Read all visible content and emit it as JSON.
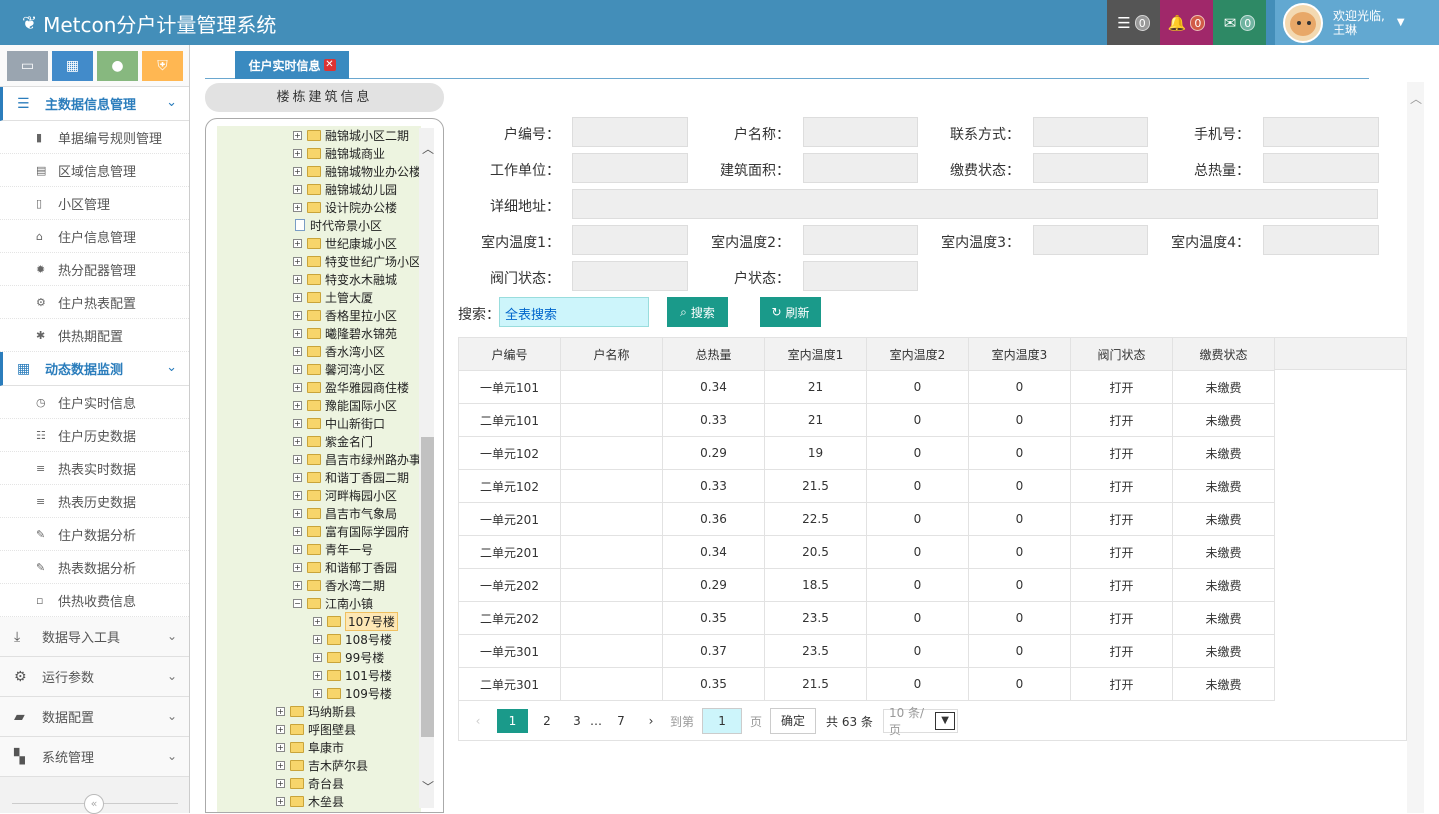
{
  "app": {
    "title": "Metcon分户计量管理系统"
  },
  "header": {
    "badges": [
      {
        "icon": "tasks-icon",
        "count": "0"
      },
      {
        "icon": "bell-icon",
        "count": "0"
      },
      {
        "icon": "envelope-icon",
        "count": "0"
      }
    ],
    "user": {
      "welcome": "欢迎光临,",
      "name": "王琳"
    }
  },
  "sidebar": {
    "groups": [
      {
        "label": "主数据信息管理",
        "items": [
          "单据编号规则管理",
          "区域信息管理",
          "小区管理",
          "住户信息管理",
          "热分配器管理",
          "住户热表配置",
          "供热期配置"
        ]
      },
      {
        "label": "动态数据监测",
        "items": [
          "住户实时信息",
          "住户历史数据",
          "热表实时数据",
          "热表历史数据",
          "住户数据分析",
          "热表数据分析",
          "供热收费信息"
        ]
      }
    ],
    "collapsed": [
      "数据导入工具",
      "运行参数",
      "数据配置",
      "系统管理"
    ],
    "collapse_glyph": "«"
  },
  "tabs": [
    {
      "label": "住户实时信息"
    }
  ],
  "tree": {
    "header": "楼栋建筑信息",
    "nodes": [
      "融锦城小区二期",
      "融锦城商业",
      "融锦城物业办公楼",
      "融锦城幼儿园",
      "设计院办公楼",
      "时代帝景小区",
      "世纪康城小区",
      "特变世纪广场小区",
      "特变水木融城",
      "土管大厦",
      "香格里拉小区",
      "曦隆碧水锦苑",
      "香水湾小区",
      "馨河湾小区",
      "盈华雅园商住楼",
      "豫能国际小区",
      "中山新街口",
      "紫金名门",
      "昌吉市绿州路办事",
      "和谐丁香园二期",
      "河畔梅园小区",
      "昌吉市气象局",
      "富有国际学园府",
      "青年一号",
      "和谐郁丁香园",
      "香水湾二期",
      "江南小镇"
    ],
    "children": [
      "107号楼",
      "108号楼",
      "99号楼",
      "101号楼",
      "109号楼"
    ],
    "lower": [
      "玛纳斯县",
      "呼图壁县",
      "阜康市",
      "吉木萨尔县",
      "奇台县",
      "木垒县"
    ]
  },
  "form": {
    "row1": [
      "户编号：",
      "户名称：",
      "联系方式：",
      "手机号："
    ],
    "row2": [
      "工作单位：",
      "建筑面积：",
      "缴费状态：",
      "总热量："
    ],
    "address": "详细地址：",
    "row4": [
      "室内温度1：",
      "室内温度2：",
      "室内温度3：",
      "室内温度4："
    ],
    "row5": [
      "阀门状态：",
      "户状态："
    ]
  },
  "search": {
    "label": "搜索：",
    "scope": "全表搜索",
    "search_btn": "搜索",
    "refresh_btn": "刷新"
  },
  "table": {
    "headers": [
      "户编号",
      "户名称",
      "总热量",
      "室内温度1",
      "室内温度2",
      "室内温度3",
      "阀门状态",
      "缴费状态"
    ],
    "rows": [
      [
        "一单元101",
        "",
        "0.34",
        "21",
        "0",
        "0",
        "打开",
        "未缴费"
      ],
      [
        "二单元101",
        "",
        "0.33",
        "21",
        "0",
        "0",
        "打开",
        "未缴费"
      ],
      [
        "一单元102",
        "",
        "0.29",
        "19",
        "0",
        "0",
        "打开",
        "未缴费"
      ],
      [
        "二单元102",
        "",
        "0.33",
        "21.5",
        "0",
        "0",
        "打开",
        "未缴费"
      ],
      [
        "一单元201",
        "",
        "0.36",
        "22.5",
        "0",
        "0",
        "打开",
        "未缴费"
      ],
      [
        "二单元201",
        "",
        "0.34",
        "20.5",
        "0",
        "0",
        "打开",
        "未缴费"
      ],
      [
        "一单元202",
        "",
        "0.29",
        "18.5",
        "0",
        "0",
        "打开",
        "未缴费"
      ],
      [
        "二单元202",
        "",
        "0.35",
        "23.5",
        "0",
        "0",
        "打开",
        "未缴费"
      ],
      [
        "一单元301",
        "",
        "0.37",
        "23.5",
        "0",
        "0",
        "打开",
        "未缴费"
      ],
      [
        "二单元301",
        "",
        "0.35",
        "21.5",
        "0",
        "0",
        "打开",
        "未缴费"
      ]
    ]
  },
  "pager": {
    "prev": "‹",
    "pages": [
      "1",
      "2",
      "3",
      "…",
      "7"
    ],
    "next": "›",
    "goto_label": "到第",
    "current": "1",
    "page_unit": "页",
    "ok": "确定",
    "total": "共 63 条",
    "page_size": "10 条/页"
  }
}
